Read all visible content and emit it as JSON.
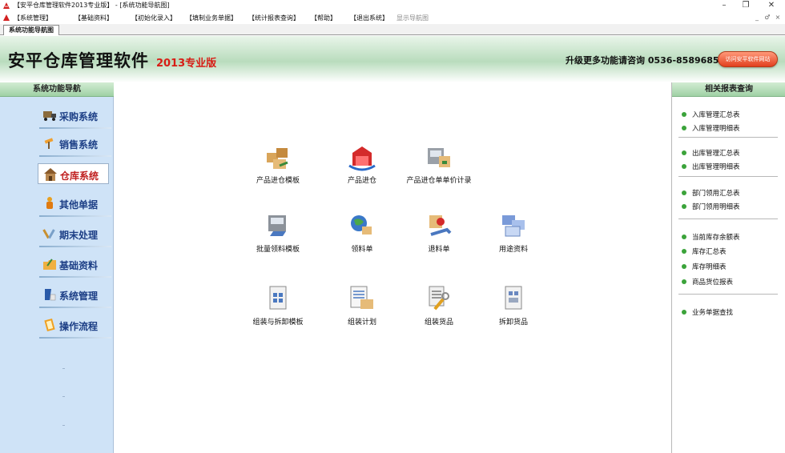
{
  "window": {
    "title": "【安平仓库管理软件2013专业版】 - [系统功能导航图]",
    "controls": {
      "minimize": "–",
      "restore": "❐",
      "close": "✕"
    }
  },
  "menubar": {
    "items": [
      "【系统管理】",
      "【基础资料】",
      "【初始化录入】",
      "【填制业务单据】",
      "【统计报表查询】",
      "【帮助】",
      "【退出系统】",
      "显示导航图"
    ],
    "mdi_controls": [
      "_",
      "♂",
      "×"
    ]
  },
  "tabs": [
    "系统功能导航图"
  ],
  "banner": {
    "brand": "安平仓库管理软件",
    "edition": "2013专业版",
    "contact": "升级更多功能请咨询  0536-8589685",
    "visit_button": "访问安平软件网站"
  },
  "leftnav": {
    "title": "系统功能导航",
    "items": [
      {
        "label": "采购系统",
        "icon": "truck-icon"
      },
      {
        "label": "销售系统",
        "icon": "hammer-icon"
      },
      {
        "label": "仓库系统",
        "icon": "warehouse-icon",
        "active": true
      },
      {
        "label": "其他单据",
        "icon": "person-doc-icon"
      },
      {
        "label": "期末处理",
        "icon": "tools-icon"
      },
      {
        "label": "基础资料",
        "icon": "folder-pencil-icon"
      },
      {
        "label": "系统管理",
        "icon": "user-admin-icon"
      },
      {
        "label": "操作流程",
        "icon": "flow-book-icon"
      }
    ]
  },
  "center": {
    "functions": [
      {
        "label": "产品进仓模板",
        "icon": "boxes-template-icon"
      },
      {
        "label": "产品进仓",
        "icon": "stock-in-icon"
      },
      {
        "label": "产品进仓单单价计录",
        "icon": "price-record-icon"
      },
      {
        "label": "批量领料模板",
        "icon": "batch-issue-icon"
      },
      {
        "label": "领料单",
        "icon": "globe-issue-icon"
      },
      {
        "label": "退料单",
        "icon": "return-icon"
      },
      {
        "label": "用途资料",
        "icon": "usage-data-icon"
      },
      {
        "label": "组装与拆卸模板",
        "icon": "assemble-template-icon"
      },
      {
        "label": "组装计划",
        "icon": "assemble-plan-icon"
      },
      {
        "label": "组装货品",
        "icon": "assemble-goods-icon"
      },
      {
        "label": "拆卸货品",
        "icon": "disassemble-goods-icon"
      }
    ]
  },
  "rightpanel": {
    "title": "相关报表查询",
    "groups": [
      [
        "入库管理汇总表",
        "入库管理明细表"
      ],
      [
        "出库管理汇总表",
        "出库管理明细表"
      ],
      [
        "部门领用汇总表",
        "部门领用明细表"
      ],
      [
        "当前库存余额表",
        "库存汇总表",
        "库存明细表",
        "商品货位报表"
      ],
      [
        "业务单据查找"
      ]
    ]
  }
}
